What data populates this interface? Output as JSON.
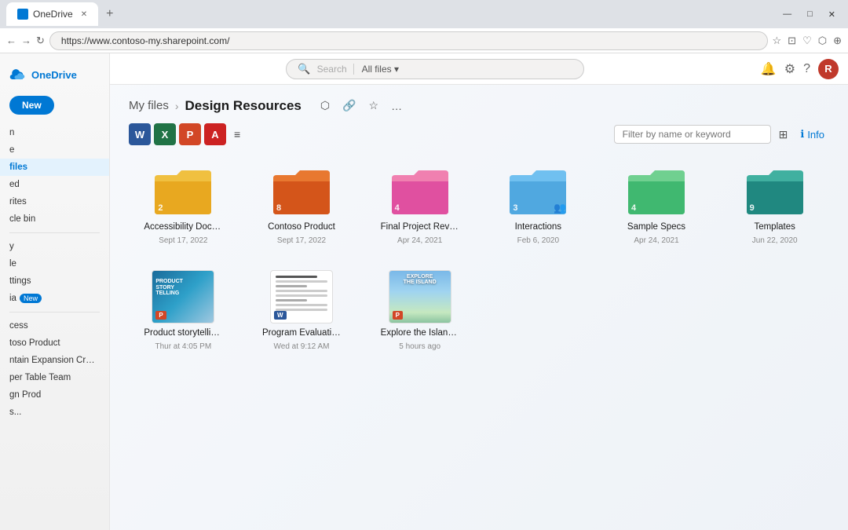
{
  "browser": {
    "tab_title": "OneDrive",
    "tab_favicon": "cloud",
    "url": "https://www.contoso-my.sharepoint.com/",
    "new_tab_label": "+",
    "win_minimize": "—",
    "win_restore": "□",
    "win_close": "✕"
  },
  "header": {
    "logo_text": "OneDrive",
    "search_placeholder": "Search",
    "all_files_label": "All files",
    "all_files_chevron": "▾",
    "actions": {
      "share": "🔔",
      "settings": "⚙",
      "help": "?",
      "user_initial": "R"
    }
  },
  "breadcrumb": {
    "myfiles": "My files",
    "separator": "›",
    "current": "Design Resources",
    "action_share": "⬡",
    "action_link": "🔗",
    "action_star": "☆",
    "action_more": "…"
  },
  "toolbar": {
    "word_label": "W",
    "excel_label": "X",
    "ppt_label": "P",
    "pdf_label": "A",
    "filter_icon": "≡",
    "filter_placeholder": "Filter by name or keyword",
    "view_icon": "⊞",
    "info_label": "Info"
  },
  "folders": [
    {
      "name": "Accessibility Documents",
      "date": "Sept 17, 2022",
      "count": "2",
      "color_top": "#f0c040",
      "color_body": "#e8a820",
      "shared": false
    },
    {
      "name": "Contoso Product",
      "date": "Sept 17, 2022",
      "count": "8",
      "color_top": "#e87830",
      "color_body": "#d4551a",
      "shared": false
    },
    {
      "name": "Final Project Review",
      "date": "Apr 24, 2021",
      "count": "4",
      "color_top": "#f080b0",
      "color_body": "#e050a0",
      "shared": false
    },
    {
      "name": "Interactions",
      "date": "Feb 6, 2020",
      "count": "3",
      "color_top": "#70c0f0",
      "color_body": "#50a8e0",
      "shared": true
    },
    {
      "name": "Sample Specs",
      "date": "Apr 24, 2021",
      "count": "4",
      "color_top": "#70d090",
      "color_body": "#40b870",
      "shared": false
    },
    {
      "name": "Templates",
      "date": "Jun 22, 2020",
      "count": "9",
      "color_top": "#40b0a0",
      "color_body": "#208880",
      "shared": false
    }
  ],
  "files": [
    {
      "name": "Product storytelling.pptx",
      "short_name": "Product storytelling.pptx",
      "date": "Thur at 4:05 PM",
      "type": "pptx",
      "thumb_type": "storytelling"
    },
    {
      "name": "Program Evaluation Re...",
      "short_name": "Program Evaluation Re...",
      "date": "Wed at 9:12 AM",
      "type": "docx",
      "thumb_type": "program"
    },
    {
      "name": "Explore the Island - De...",
      "short_name": "Explore the Island - De...",
      "date": "5 hours ago",
      "type": "pptx",
      "thumb_type": "island"
    }
  ],
  "sidebar": {
    "new_button": "New",
    "items": [
      {
        "label": "n",
        "key": "nav1"
      },
      {
        "label": "e",
        "key": "nav2"
      },
      {
        "label": "files",
        "key": "myfiles",
        "active": true
      },
      {
        "label": "ed",
        "key": "nav4"
      },
      {
        "label": "rites",
        "key": "nav5"
      },
      {
        "label": "cle bin",
        "key": "nav6"
      },
      {
        "label": "y",
        "key": "nav7"
      },
      {
        "label": "le",
        "key": "nav8"
      },
      {
        "label": "ttings",
        "key": "settings"
      },
      {
        "label": "ia",
        "key": "media",
        "has_new": true
      },
      {
        "label": "cess",
        "key": "access"
      },
      {
        "label": "toso Product",
        "key": "conproj"
      },
      {
        "label": "ntain Expansion Crew...",
        "key": "mountain"
      },
      {
        "label": "per Table Team",
        "key": "supertable"
      },
      {
        "label": "gn Prod",
        "key": "design"
      },
      {
        "label": "s...",
        "key": "more"
      }
    ]
  },
  "colors": {
    "accent": "#0078d4",
    "brand_blue": "#0078d4",
    "folder_yellow_top": "#f0c040",
    "folder_yellow_body": "#e8a820"
  }
}
